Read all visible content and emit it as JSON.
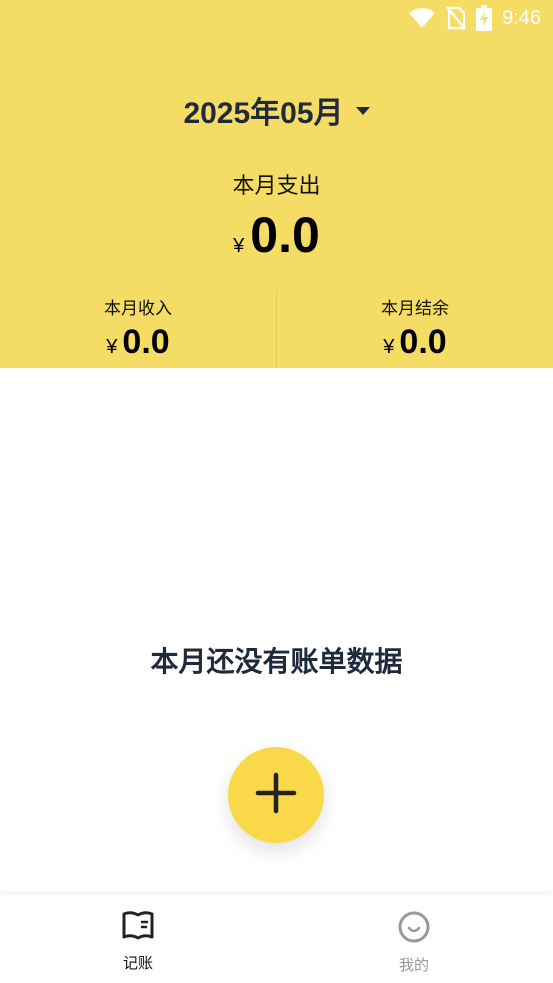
{
  "status_bar": {
    "time": "9:46",
    "icons": [
      "wifi-icon",
      "no-sim-icon",
      "battery-charging-icon"
    ]
  },
  "header": {
    "month": "2025年05月",
    "expense_label": "本月支出",
    "currency": "¥",
    "expense_amount": "0.0",
    "income_label": "本月收入",
    "income_amount": "0.0",
    "balance_label": "本月结余",
    "balance_amount": "0.0"
  },
  "main": {
    "empty_message": "本月还没有账单数据",
    "add_button_icon": "plus-icon"
  },
  "bottom_nav": {
    "items": [
      {
        "label": "记账",
        "icon": "ledger-book-icon",
        "active": true
      },
      {
        "label": "我的",
        "icon": "smiley-face-icon",
        "active": false
      }
    ]
  },
  "colors": {
    "header_bg": "#f5dc64",
    "fab_bg": "#f9d84a",
    "text_dark": "#1f2a3b",
    "nav_inactive": "#999999"
  }
}
